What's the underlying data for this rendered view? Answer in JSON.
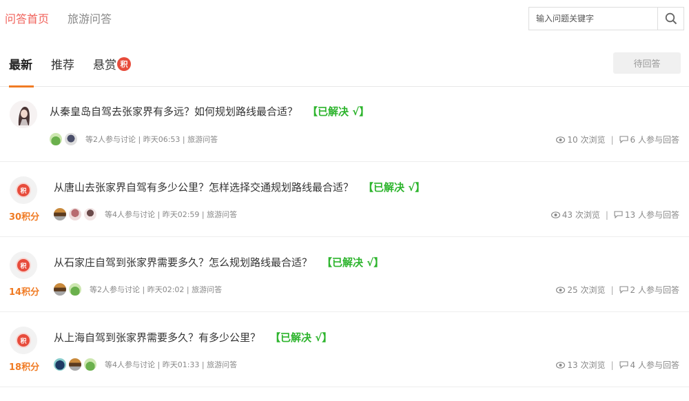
{
  "topnav": {
    "active": "问答首页",
    "other": "旅游问答"
  },
  "search": {
    "placeholder": "输入问题关键字",
    "icon": "search-icon"
  },
  "tabs": [
    {
      "label": "最新"
    },
    {
      "label": "推荐"
    },
    {
      "label": "悬赏",
      "badge": "积"
    }
  ],
  "pending_button": "待回答",
  "questions": [
    {
      "title": "从秦皇岛自驾去张家界有多远？如何规划路线最合适？",
      "status": "【已解决 √】",
      "meta": "等2人参与讨论 | 昨天06:53 | 旅游问答",
      "views": "10 次浏览",
      "answers": "6 人参与回答",
      "points": null,
      "avatars": [
        "green",
        "dark"
      ]
    },
    {
      "title": "从唐山去张家界自驾有多少公里？怎样选择交通规划路线最合适？",
      "status": "【已解决 √】",
      "meta": "等4人参与讨论 | 昨天02:59 | 旅游问答",
      "views": "43 次浏览",
      "answers": "13 人参与回答",
      "points": "30积分",
      "avatars": [
        "brown",
        "pink",
        "girl"
      ]
    },
    {
      "title": "从石家庄自驾到张家界需要多久？怎么规划路线最合适？",
      "status": "【已解决 √】",
      "meta": "等2人参与讨论 | 昨天02:02 | 旅游问答",
      "views": "25 次浏览",
      "answers": "2 人参与回答",
      "points": "14积分",
      "avatars": [
        "brown",
        "green"
      ]
    },
    {
      "title": "从上海自驾到张家界需要多久？有多少公里？",
      "status": "【已解决 √】",
      "meta": "等4人参与讨论 | 昨天01:33 | 旅游问答",
      "views": "13 次浏览",
      "answers": "4 人参与回答",
      "points": "18积分",
      "avatars": [
        "navy",
        "brown",
        "green"
      ]
    }
  ],
  "points_icon_label": "积",
  "colors": {
    "accent": "#f0625b",
    "tab_underline": "#f07b24",
    "solved": "#2db42d",
    "points": "#f07b24",
    "badge": "#e74c3c"
  }
}
